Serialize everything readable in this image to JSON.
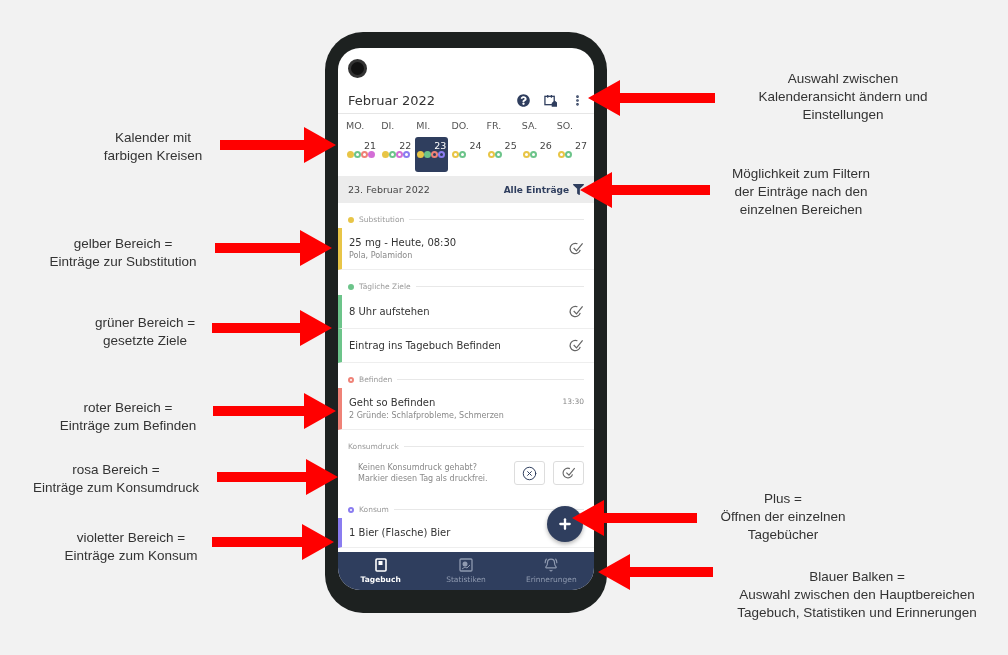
{
  "phone": {
    "header": {
      "title": "Februar 2022"
    },
    "calendar": {
      "weekdays": [
        "MO.",
        "DI.",
        "MI.",
        "DO.",
        "FR.",
        "SA.",
        "SO."
      ],
      "days": [
        {
          "label": "21",
          "selected": false,
          "dots": [
            {
              "color": "#e8c547",
              "filled": true
            },
            {
              "color": "#6cc48a",
              "filled": false
            },
            {
              "color": "#ef8277",
              "filled": false
            },
            {
              "color": "#d36ed6",
              "filled": true
            }
          ]
        },
        {
          "label": "22",
          "selected": false,
          "dots": [
            {
              "color": "#e8c547",
              "filled": true
            },
            {
              "color": "#6cc48a",
              "filled": false
            },
            {
              "color": "#d36ed6",
              "filled": false
            },
            {
              "color": "#8a7cf0",
              "filled": false
            }
          ]
        },
        {
          "label": "23",
          "selected": true,
          "dots": [
            {
              "color": "#e8c547",
              "filled": true
            },
            {
              "color": "#6cc48a",
              "filled": true
            },
            {
              "color": "#ef8277",
              "filled": false
            },
            {
              "color": "#8a7cf0",
              "filled": false
            }
          ]
        },
        {
          "label": "24",
          "selected": false,
          "dots": [
            {
              "color": "#e8c547",
              "filled": false
            },
            {
              "color": "#6cc48a",
              "filled": false
            }
          ]
        },
        {
          "label": "25",
          "selected": false,
          "dots": [
            {
              "color": "#e8c547",
              "filled": false
            },
            {
              "color": "#6cc48a",
              "filled": false
            }
          ]
        },
        {
          "label": "26",
          "selected": false,
          "dots": [
            {
              "color": "#e8c547",
              "filled": false
            },
            {
              "color": "#6cc48a",
              "filled": false
            }
          ]
        },
        {
          "label": "27",
          "selected": false,
          "dots": [
            {
              "color": "#e8c547",
              "filled": false
            },
            {
              "color": "#6cc48a",
              "filled": false
            }
          ]
        }
      ]
    },
    "date_bar": {
      "date": "23. Februar 2022",
      "filter": "Alle Einträge"
    },
    "sections": [
      {
        "title": "Substitution",
        "kind": "entries",
        "color": "#e8c547",
        "dot_filled": true,
        "entries": [
          {
            "title": "25 mg - Heute, 08:30",
            "subtitle": "Pola, Polamidon",
            "kind": "checkable"
          }
        ]
      },
      {
        "title": "Tägliche Ziele",
        "kind": "entries",
        "color": "#6cc48a",
        "dot_filled": true,
        "entries": [
          {
            "title": "8 Uhr aufstehen",
            "kind": "checkable"
          },
          {
            "title": "Eintrag ins Tagebuch Befinden",
            "kind": "checkable"
          }
        ]
      },
      {
        "title": "Befinden",
        "kind": "entries",
        "color": "#ef8277",
        "dot_filled": false,
        "entries": [
          {
            "title": "Geht so Befinden",
            "subtitle": "2 Gründe: Schlafprobleme, Schmerzen",
            "time": "13:30",
            "kind": "timed"
          }
        ]
      },
      {
        "title": "Konsumdruck",
        "kind": "prompt",
        "text": "Keinen Konsumdruck gehabt?\nMarkier diesen Tag als druckfrei."
      },
      {
        "title": "Konsum",
        "kind": "entries",
        "color": "#8a7cf0",
        "dot_filled": false,
        "entries": [
          {
            "title": "1 Bier (Flasche) Bier",
            "kind": "timed"
          }
        ]
      }
    ],
    "nav": [
      {
        "label": "Tagebuch",
        "selected": true
      },
      {
        "label": "Statistiken",
        "selected": false
      },
      {
        "label": "Erinnerungen",
        "selected": false
      }
    ]
  },
  "annotations_left": [
    {
      "text": "Kalender mit\nfarbigen Kreisen"
    },
    {
      "text": "gelber Bereich =\nEinträge zur Substitution"
    },
    {
      "text": "grüner Bereich =\ngesetzte Ziele"
    },
    {
      "text": "roter Bereich =\nEinträge zum Befinden"
    },
    {
      "text": "rosa Bereich =\nEinträge zum Konsumdruck"
    },
    {
      "text": "violetter Bereich =\nEinträge zum Konsum"
    }
  ],
  "annotations_right": [
    {
      "text": "Auswahl zwischen\nKalenderansicht ändern und\nEinstellungen"
    },
    {
      "text": "Möglichkeit zum Filtern\nder Einträge nach den\neinzelnen Bereichen"
    },
    {
      "text": "Plus =\nÖffnen der einzelnen\nTagebücher"
    },
    {
      "text": "Blauer Balken =\nAuswahl zwischen den Hauptbereichen\nTagebuch, Statistiken und Erinnerungen"
    }
  ]
}
